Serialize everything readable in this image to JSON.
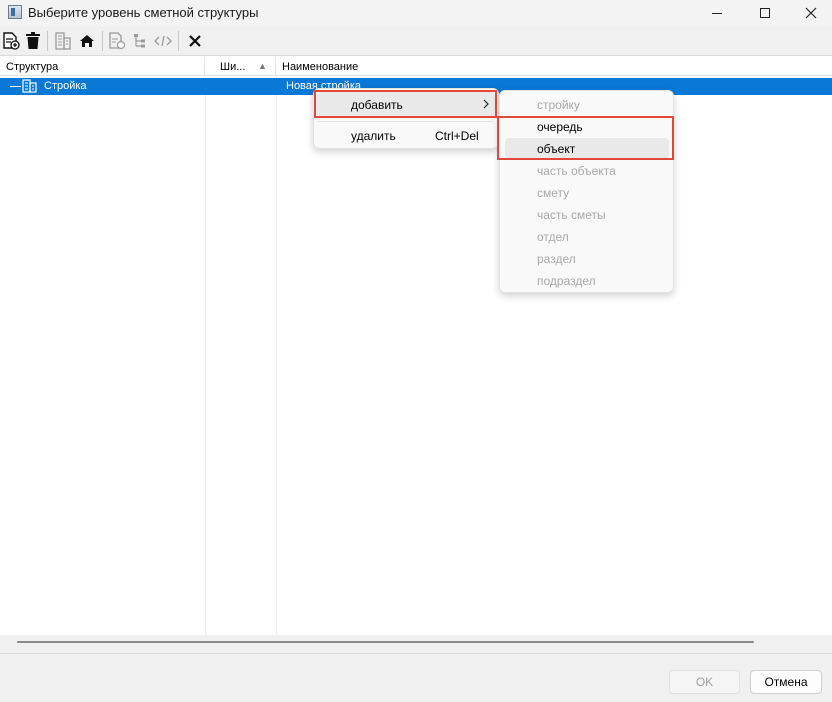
{
  "window": {
    "title": "Выберите уровень сметной структуры"
  },
  "toolbar": {
    "buttons": [
      {
        "icon": "add-document-icon",
        "enabled": true
      },
      {
        "icon": "trash-icon",
        "enabled": true
      },
      {
        "icon": "building-icon",
        "enabled": false
      },
      {
        "icon": "house-icon",
        "enabled": true
      },
      {
        "icon": "document-settings-icon",
        "enabled": false
      },
      {
        "icon": "tree-structure-icon",
        "enabled": false
      },
      {
        "icon": "code-brackets-icon",
        "enabled": false
      },
      {
        "icon": "close-x-icon",
        "enabled": true
      }
    ]
  },
  "grid": {
    "columns": {
      "structure": "Структура",
      "width": "Ши...",
      "name": "Наименование"
    },
    "rows": [
      {
        "structure": "Стройка",
        "name": "Новая стройка",
        "selected": true
      }
    ]
  },
  "context_menu": {
    "add_label": "добавить",
    "add_arrow": ">",
    "delete_label": "удалить",
    "delete_shortcut": "Ctrl+Del"
  },
  "submenu": {
    "items": [
      {
        "label": "стройку",
        "enabled": false
      },
      {
        "label": "очередь",
        "enabled": true
      },
      {
        "label": "объект",
        "enabled": true,
        "hovered": true
      },
      {
        "label": "часть объекта",
        "enabled": false
      },
      {
        "label": "смету",
        "enabled": false
      },
      {
        "label": "часть сметы",
        "enabled": false
      },
      {
        "label": "отдел",
        "enabled": false
      },
      {
        "label": "раздел",
        "enabled": false
      },
      {
        "label": "подраздел",
        "enabled": false
      }
    ]
  },
  "footer": {
    "ok_label": "OK",
    "ok_enabled": false,
    "cancel_label": "Отмена"
  },
  "colors": {
    "selection": "#0a78d7",
    "highlight_box": "#e0483c"
  }
}
